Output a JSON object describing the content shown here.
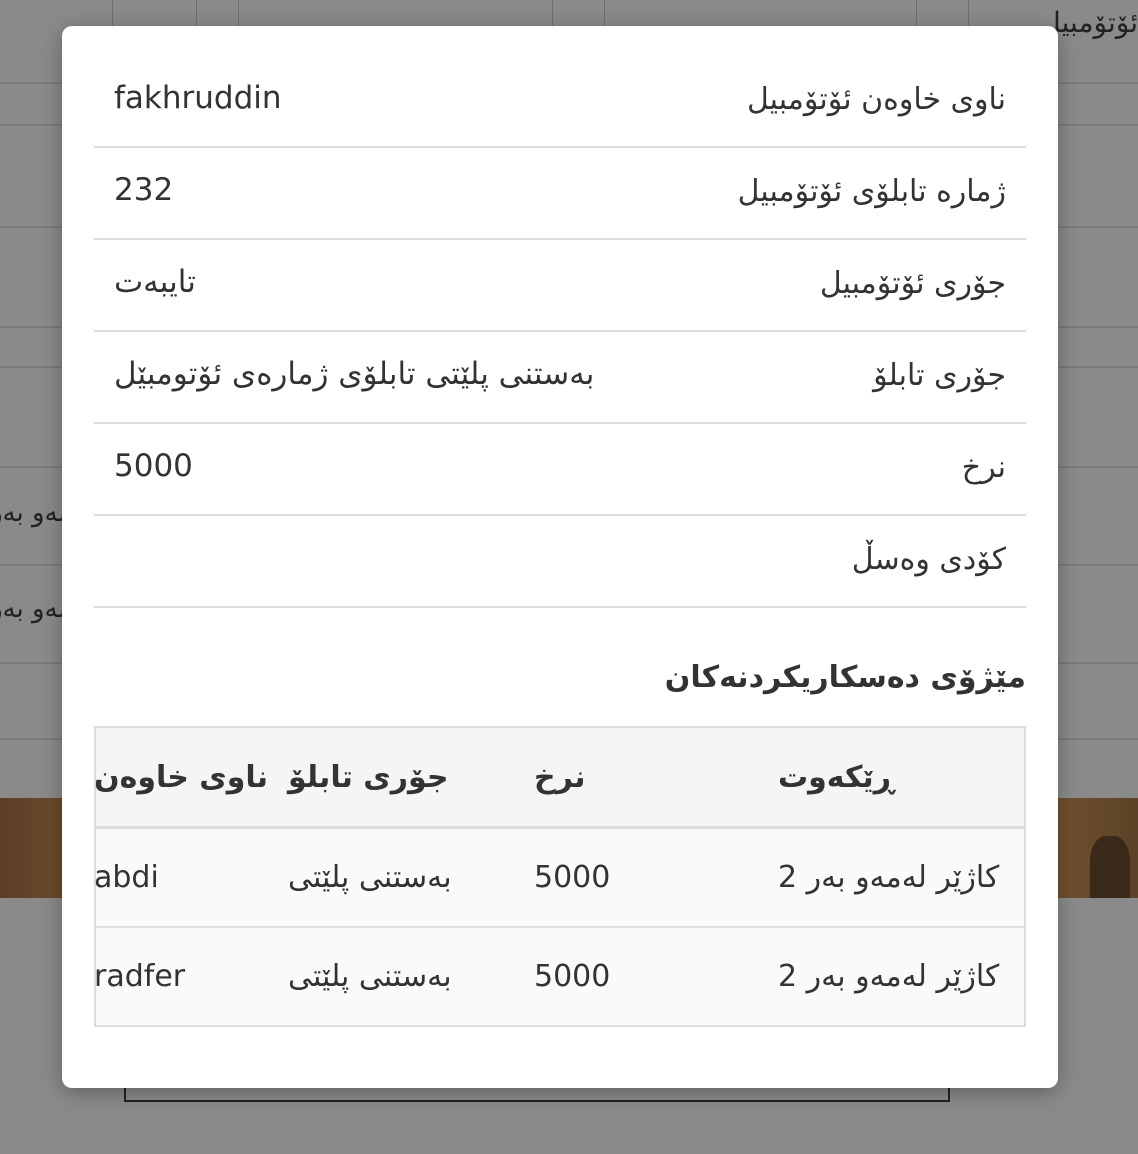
{
  "background": {
    "top_right_text": "ئۆتۆمبیل",
    "left_texts": [
      "لەمەو بەر",
      "لەمەو بەر"
    ]
  },
  "modal": {
    "details": [
      {
        "label": "ناوی خاوەن ئۆتۆمبیل",
        "value": "fakhruddin"
      },
      {
        "label": "ژمارە تابلۆی ئۆتۆمبیل",
        "value": "232"
      },
      {
        "label": "جۆری ئۆتۆمبیل",
        "value": "تایبەت"
      },
      {
        "label": "جۆری تابلۆ",
        "value": "بەستنی پلێتی تابلۆی ژمارەی ئۆتومبێل"
      },
      {
        "label": "نرخ",
        "value": "5000"
      },
      {
        "label": "کۆدی وەسڵ",
        "value": ""
      }
    ],
    "history_title": "مێژۆی دەسکاریکردنەکان",
    "history": {
      "headers": {
        "date": "ڕێکەوت",
        "price": "نرخ",
        "plate_type": "جۆری تابلۆ",
        "owner": "ناوی خاوەن"
      },
      "rows": [
        {
          "date": "کاژێر لەمەو بەر 2",
          "price": "5000",
          "plate_type": "بەستنی پلێتی",
          "owner": "abdi"
        },
        {
          "date": "کاژێر لەمەو بەر 2",
          "price": "5000",
          "plate_type": "بەستنی پلێتی",
          "owner": "radfer"
        }
      ]
    }
  }
}
